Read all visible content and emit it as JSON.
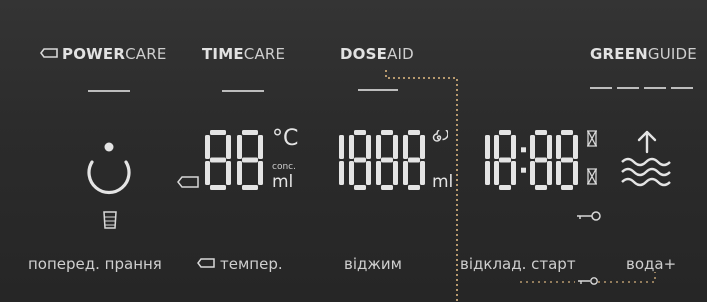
{
  "headers": {
    "power": {
      "bold": "POWER",
      "normal": "CARE"
    },
    "time": {
      "bold": "TIME",
      "normal": "CARE"
    },
    "dose": {
      "bold": "DOSE",
      "normal": "AID"
    },
    "green": {
      "bold": "GREEN",
      "normal": "GUIDE"
    }
  },
  "displays": {
    "temperature": {
      "digits": "88",
      "unit": "°C",
      "unit_small": "conc.",
      "unit_ml": "ml"
    },
    "spin": {
      "digits": "1888",
      "unit_ml": "ml"
    },
    "time": {
      "digits": "18:88"
    }
  },
  "bottom_labels": {
    "prewash": "поперед. прання",
    "temp": "темпер.",
    "spin": "віджим",
    "delay": "відклад. старт",
    "water": "вода+"
  },
  "icons": {
    "power_care": "battery-icon",
    "prewash": "power-dial-icon",
    "detergent": "detergent-cup-icon",
    "spin": "spiral-icon",
    "hourglass": "hourglass-icon",
    "key": "key-lock-icon",
    "water": "water-level-icon"
  },
  "colors": {
    "background": "#2b2b2b",
    "segment": "#e4e4e4",
    "text": "#cfcfcf",
    "dotted": "#b89a6e"
  }
}
